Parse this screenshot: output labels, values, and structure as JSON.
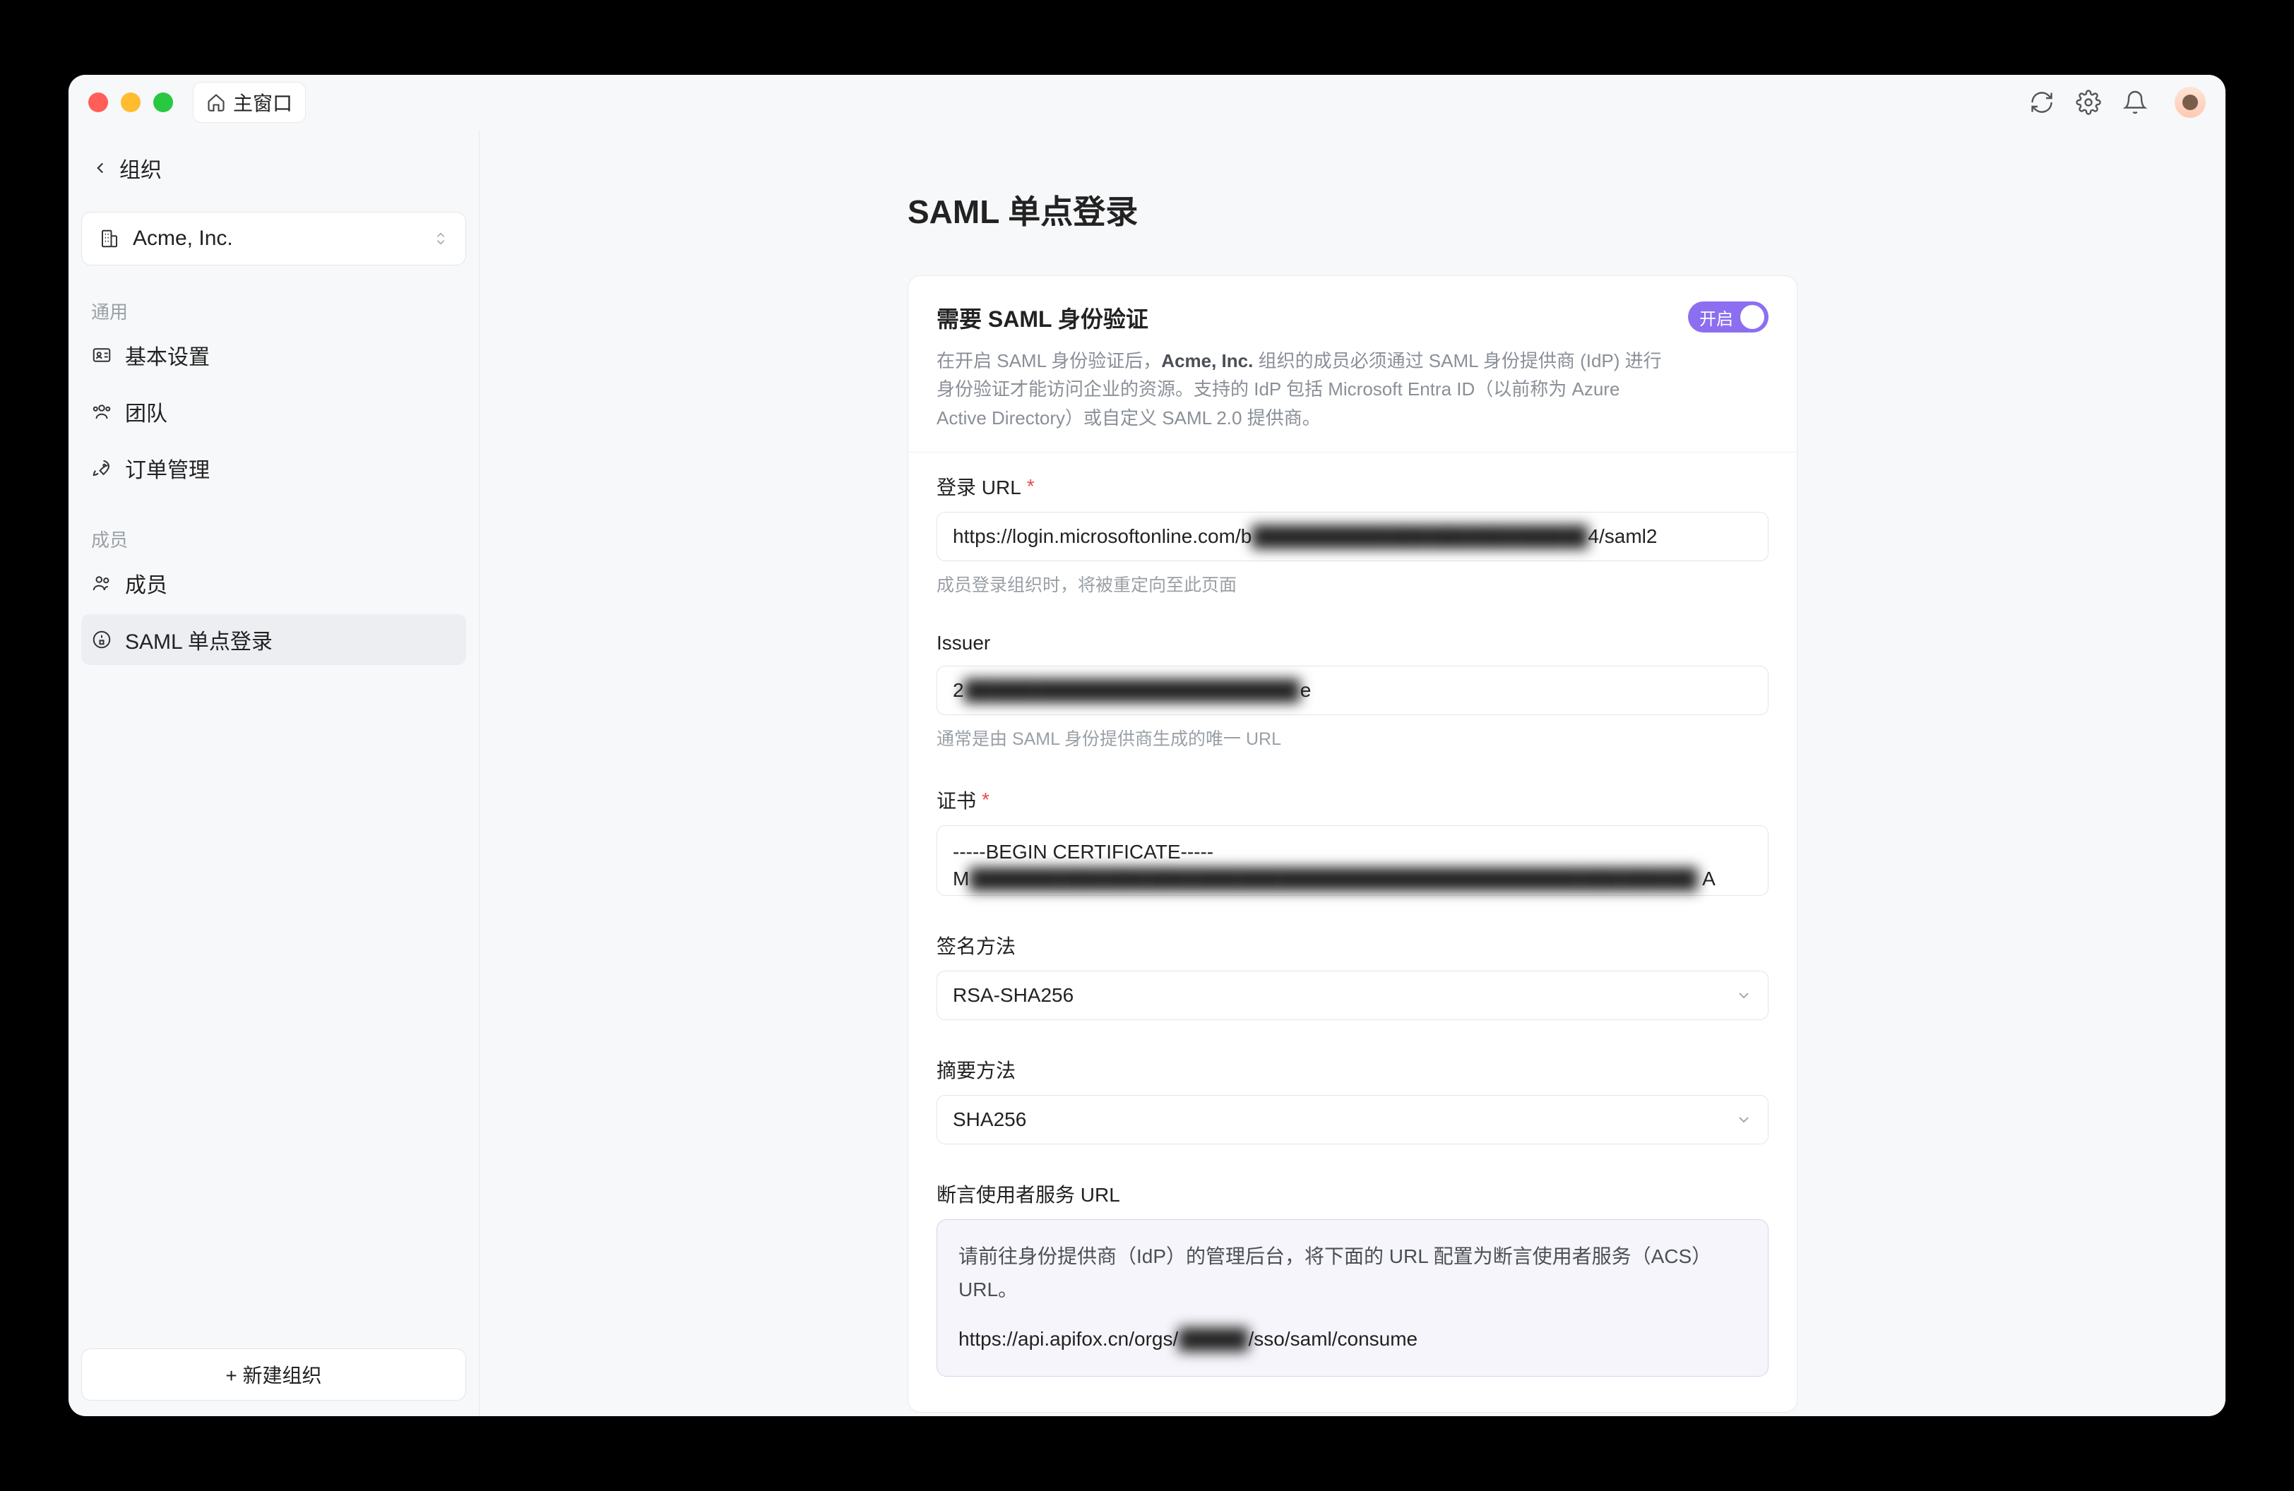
{
  "window": {
    "main_window_label": "主窗口"
  },
  "sidebar": {
    "back_label": "组织",
    "org_name": "Acme, Inc.",
    "section_general": "通用",
    "section_members": "成员",
    "items": {
      "basic": "基本设置",
      "team": "团队",
      "orders": "订单管理",
      "members": "成员",
      "saml": "SAML 单点登录"
    },
    "new_org_button": "+  新建组织"
  },
  "main": {
    "page_title": "SAML 单点登录",
    "require_card": {
      "title": "需要 SAML 身份验证",
      "desc_prefix": "在开启 SAML 身份验证后，",
      "org_name": "Acme, Inc.",
      "desc_suffix": " 组织的成员必须通过 SAML 身份提供商 (IdP) 进行身份验证才能访问企业的资源。支持的 IdP 包括 Microsoft Entra ID（以前称为 Azure Active Directory）或自定义 SAML 2.0 提供商。",
      "toggle_label": "开启"
    },
    "fields": {
      "login_url": {
        "label": "登录 URL",
        "required": true,
        "value_prefix": "https://login.microsoftonline.com/b",
        "value_redacted": "████████████████████████",
        "value_suffix": "4/saml2",
        "help": "成员登录组织时，将被重定向至此页面"
      },
      "issuer": {
        "label": "Issuer",
        "value_prefix": "2",
        "value_redacted": "████████████████████████",
        "value_suffix": "e",
        "help": "通常是由 SAML 身份提供商生成的唯一 URL"
      },
      "cert": {
        "label": "证书",
        "required": true,
        "value_line1": "-----BEGIN CERTIFICATE-----",
        "value_line2_prefix": "M",
        "value_line2_redacted": "████████████████████████████████████████████████████",
        "value_line2_suffix": " A"
      },
      "sig_method": {
        "label": "签名方法",
        "value": "RSA-SHA256"
      },
      "digest_method": {
        "label": "摘要方法",
        "value": "SHA256"
      },
      "acs": {
        "label": "断言使用者服务 URL",
        "info_text": "请前往身份提供商（IdP）的管理后台，将下面的 URL 配置为断言使用者服务（ACS）URL。",
        "url_prefix": "https://api.apifox.cn/orgs/",
        "url_redacted": "█████",
        "url_suffix": "/sso/saml/consume"
      }
    }
  }
}
